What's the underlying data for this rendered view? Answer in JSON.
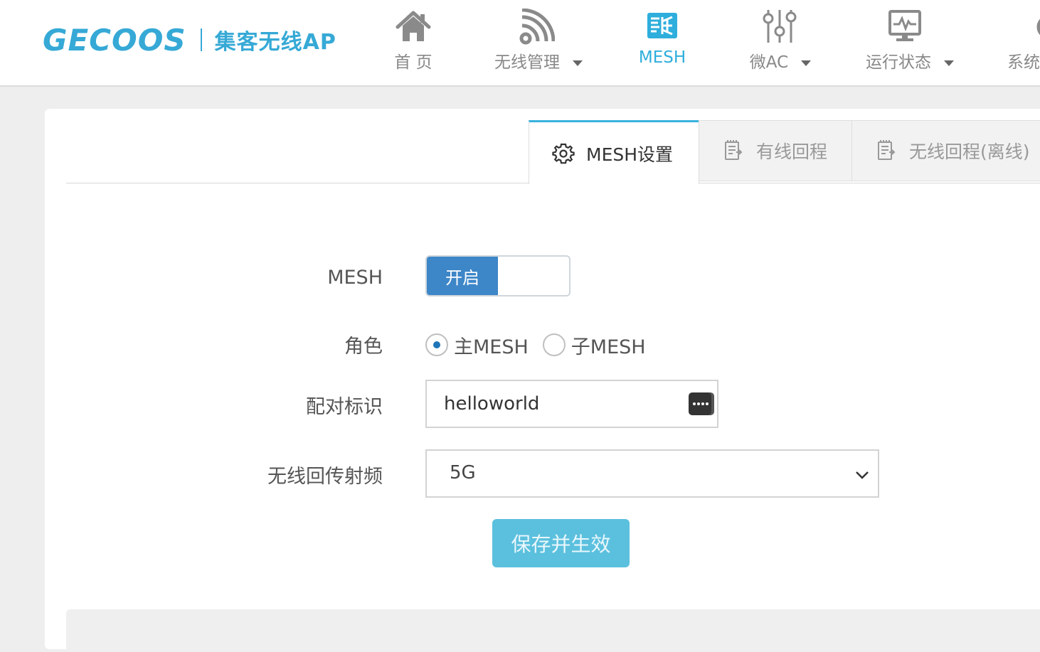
{
  "header": {
    "logo_text": "GECOOS",
    "logo_subtitle": "集客无线AP",
    "nav": [
      {
        "label": "首 页",
        "icon": "home-icon",
        "active": false,
        "dropdown": false
      },
      {
        "label": "无线管理",
        "icon": "wifi-icon",
        "active": false,
        "dropdown": true
      },
      {
        "label": "MESH",
        "icon": "mesh-icon",
        "active": true,
        "dropdown": false
      },
      {
        "label": "微AC",
        "icon": "sliders-icon",
        "active": false,
        "dropdown": true
      },
      {
        "label": "运行状态",
        "icon": "monitor-icon",
        "active": false,
        "dropdown": true
      },
      {
        "label": "系统",
        "icon": "gear-icon",
        "active": false,
        "dropdown": false
      }
    ]
  },
  "tabs": [
    {
      "label": "MESH设置",
      "icon": "gear-icon",
      "active": true
    },
    {
      "label": "有线回程",
      "icon": "document-icon",
      "active": false
    },
    {
      "label": "无线回程(离线)",
      "icon": "document-icon",
      "active": false
    }
  ],
  "form": {
    "mesh": {
      "label": "MESH",
      "toggle_text": "开启",
      "enabled": true
    },
    "role": {
      "label": "角色",
      "options": [
        {
          "label": "主MESH",
          "checked": true
        },
        {
          "label": "子MESH",
          "checked": false
        }
      ]
    },
    "pair_id": {
      "label": "配对标识",
      "value": "helloworld"
    },
    "backhaul_band": {
      "label": "无线回传射频",
      "value": "5G"
    },
    "save_label": "保存并生效"
  },
  "colors": {
    "accent": "#2eaedc",
    "toggle_on": "#3d86c8",
    "save_button": "#5bc0de",
    "radio_dot": "#1e76b8"
  }
}
